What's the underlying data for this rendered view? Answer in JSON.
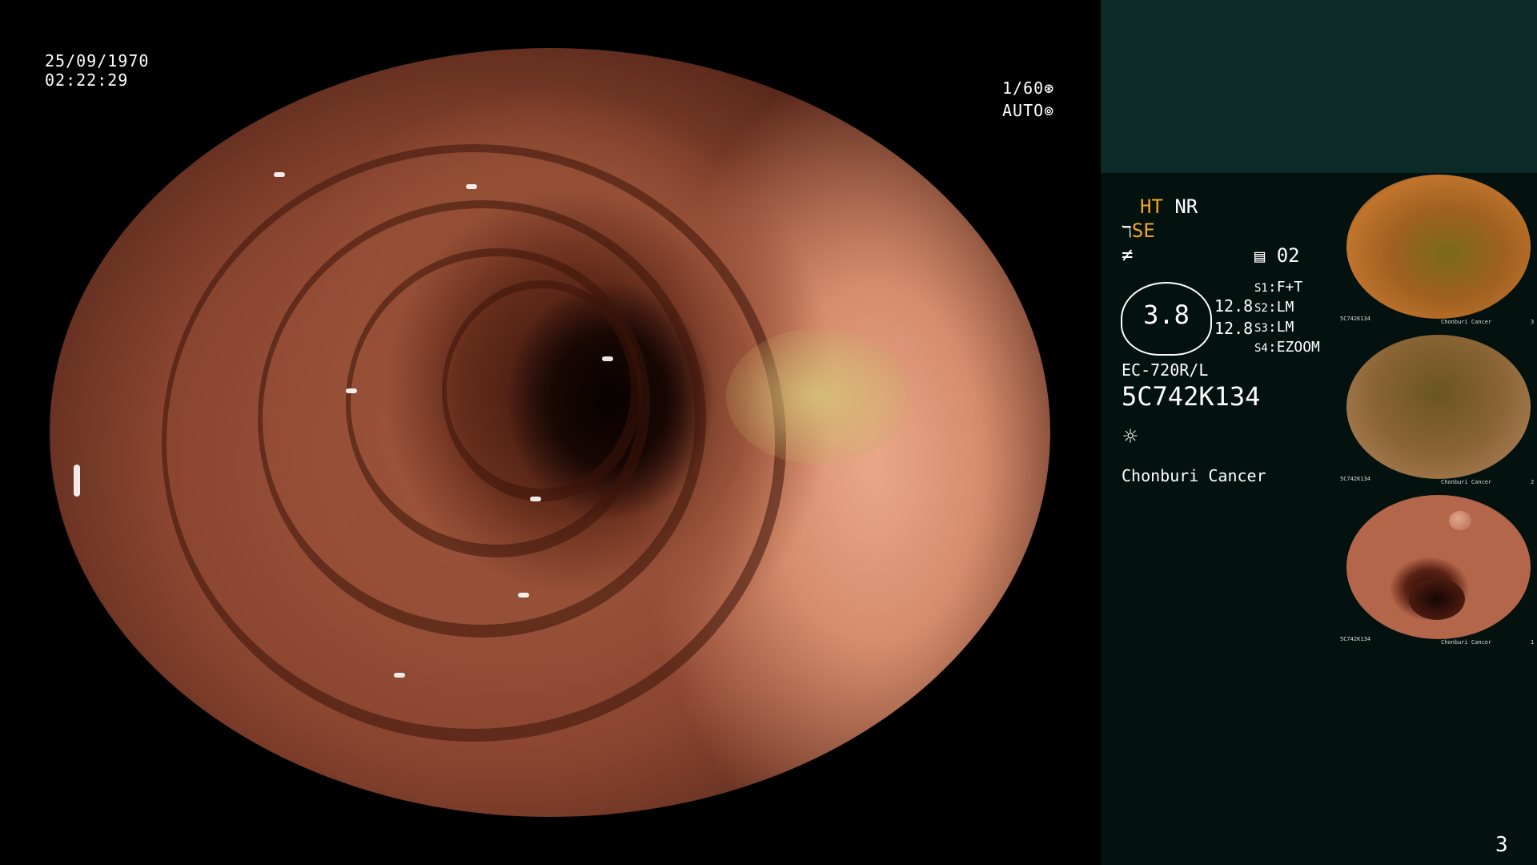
{
  "overlay": {
    "date": "25/09/1970",
    "time": "02:22:29",
    "shutter": "1/60",
    "iris_mode": "AUTO"
  },
  "panel": {
    "ht": "HT",
    "nr": "NR",
    "se": "SE",
    "counter": "02",
    "gauge_value": "3.8",
    "gauge_left_top": "12.8",
    "gauge_left_bottom": "12.8",
    "switches": [
      {
        "key": "S1",
        "value": "F+T"
      },
      {
        "key": "S2",
        "value": "LM"
      },
      {
        "key": "S3",
        "value": "LM"
      },
      {
        "key": "S4",
        "value": "EZOOM"
      }
    ],
    "scope_model": "EC-720R/L",
    "serial": "5C742K134",
    "institution": "Chonburi Cancer"
  },
  "thumbnails": [
    {
      "label_left": "5C742K134",
      "label_center": "Chonburi Cancer",
      "index": "3"
    },
    {
      "label_left": "5C742K134",
      "label_center": "Chonburi Cancer",
      "index": "2"
    },
    {
      "label_left": "5C742K134",
      "label_center": "Chonburi Cancer",
      "index": "1"
    }
  ],
  "page_number": "3",
  "icons": [
    "aperture-icon",
    "auto-iris-icon",
    "memory-card-icon",
    "light-icon",
    "se-mode-icon",
    "lens-icon"
  ],
  "colors": {
    "accent": "#f2a623",
    "panel_top": "#0c2a28",
    "panel_body": "#03110f"
  }
}
